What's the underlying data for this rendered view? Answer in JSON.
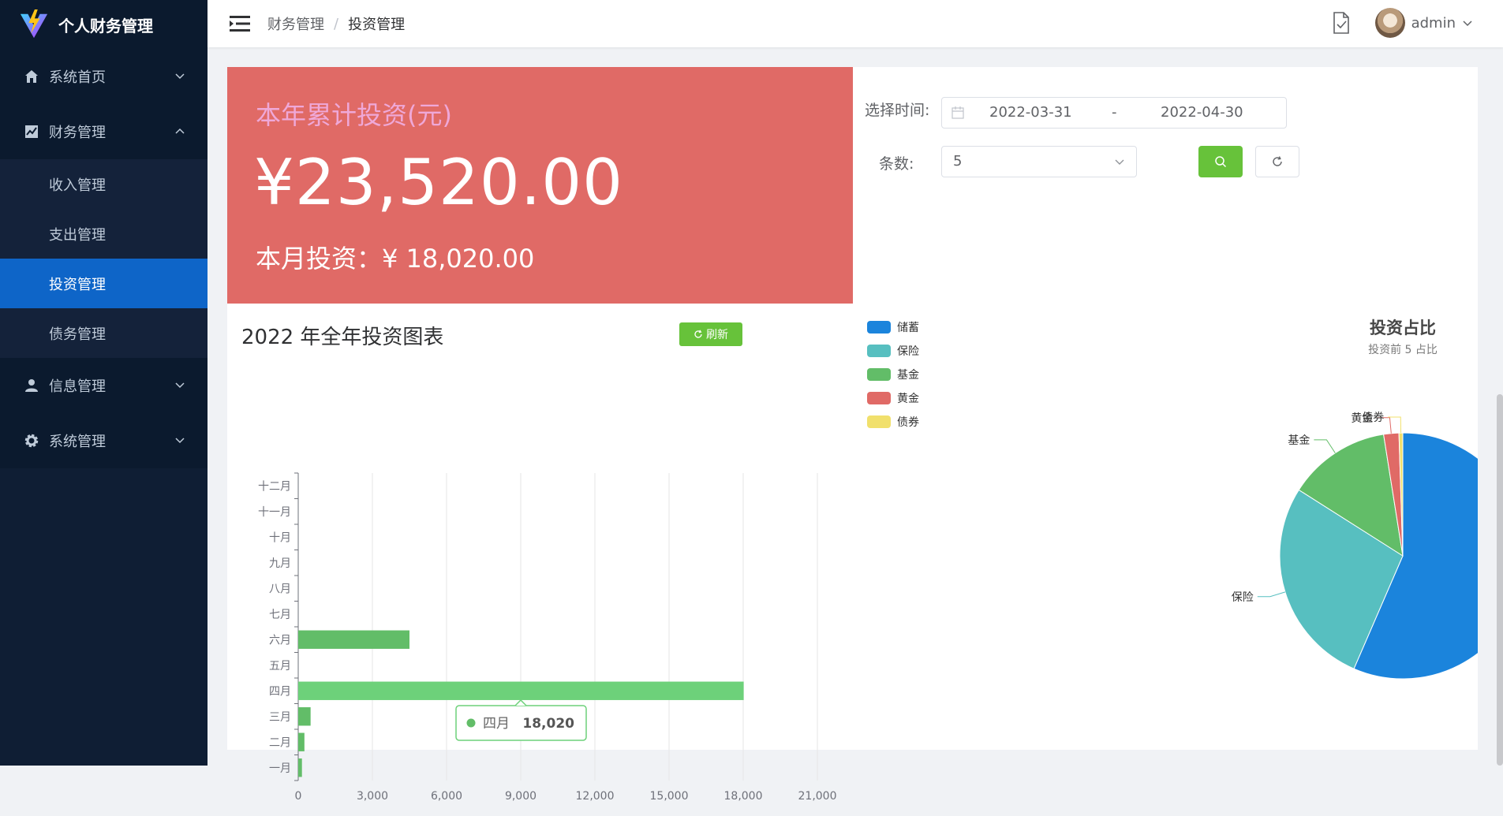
{
  "app": {
    "title": "个人财务管理"
  },
  "sidebar": {
    "items": [
      {
        "label": "系统首页",
        "icon": "home-icon",
        "expanded": false
      },
      {
        "label": "财务管理",
        "icon": "chart-icon",
        "expanded": true,
        "children": [
          {
            "label": "收入管理",
            "active": false
          },
          {
            "label": "支出管理",
            "active": false
          },
          {
            "label": "投资管理",
            "active": true
          },
          {
            "label": "债务管理",
            "active": false
          }
        ]
      },
      {
        "label": "信息管理",
        "icon": "user-icon",
        "expanded": false
      },
      {
        "label": "系统管理",
        "icon": "gear-icon",
        "expanded": false
      }
    ]
  },
  "header": {
    "breadcrumb": [
      "财务管理",
      "投资管理"
    ],
    "separator": "/",
    "username": "admin"
  },
  "summary": {
    "title": "本年累计投资(元)",
    "total": "¥23,520.00",
    "month": "本月投资：¥ 18,020.00",
    "bg_color": "#e06a66"
  },
  "bar_section": {
    "title": "2022 年全年投资图表",
    "refresh_label": "刷新"
  },
  "filters": {
    "time_label": "选择时间:",
    "date_start": "2022-03-31",
    "date_separator": "-",
    "date_end": "2022-04-30",
    "count_label": "条数:",
    "count_value": "5"
  },
  "chart_data": [
    {
      "type": "bar",
      "orientation": "horizontal",
      "categories": [
        "一月",
        "二月",
        "三月",
        "四月",
        "五月",
        "六月",
        "七月",
        "八月",
        "九月",
        "十月",
        "十一月",
        "十二月"
      ],
      "values": [
        150,
        250,
        500,
        18020,
        0,
        4500,
        0,
        0,
        0,
        0,
        0,
        0
      ],
      "xlim": [
        0,
        21000
      ],
      "xticks": [
        "0",
        "3,000",
        "6,000",
        "9,000",
        "12,000",
        "15,000",
        "18,000",
        "21,000"
      ],
      "color": "#62bd68",
      "highlight_color": "#6dd17a",
      "tooltip": {
        "label": "四月",
        "value": "18,020"
      }
    },
    {
      "type": "pie",
      "title": "投资占比",
      "subtitle": "投资前 5 占比",
      "legend_position": "top-left",
      "slices": [
        {
          "name": "储蓄",
          "value": 56.5,
          "color": "#1b84dc"
        },
        {
          "name": "保险",
          "value": 27.5,
          "color": "#57bfc0"
        },
        {
          "name": "基金",
          "value": 13.5,
          "color": "#62bd68"
        },
        {
          "name": "黄金",
          "value": 2.0,
          "color": "#e06a66"
        },
        {
          "name": "债券",
          "value": 0.5,
          "color": "#f1e06c"
        }
      ]
    }
  ]
}
